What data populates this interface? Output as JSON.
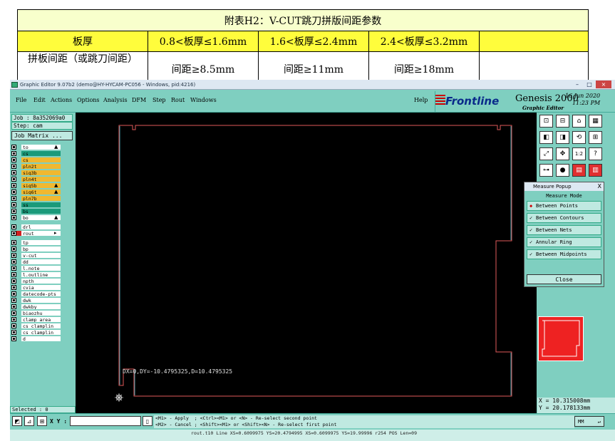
{
  "doc_table": {
    "title": "附表H2：V-CUT跳刀拼版间距参数",
    "header_row": [
      "板厚",
      "0.8<板厚≤1.6mm",
      "1.6<板厚≤2.4mm",
      "2.4<板厚≤3.2mm",
      ""
    ],
    "data_row": [
      "拼板间距（或跳刀间距）",
      "间距≥8.5mm",
      "间距≥11mm",
      "间距≥18mm",
      ""
    ]
  },
  "window": {
    "title": "Graphic Editor 9.07b2 (demo@HY-HYCAM-PC056 - Windows, pid:4216)",
    "controls": [
      "–",
      "□",
      "×"
    ]
  },
  "menu": {
    "items": [
      "File",
      "Edit",
      "Actions",
      "Options",
      "Analysis",
      "DFM",
      "Step",
      "Rout",
      "Windows"
    ],
    "help": "Help"
  },
  "branding": {
    "logo": "Frontline",
    "product": "Genesis 2000",
    "date": "16 Jun 2020",
    "time": "11:23 PM",
    "subtitle": "Graphic Editor"
  },
  "job": {
    "job_line": "Job : 8a352069a0",
    "step_line": "Step: cam",
    "matrix_button": "Job Matrix ..."
  },
  "layers": {
    "group1": [
      {
        "name": "to",
        "bg": "#ffffff",
        "arrow": "▲"
      },
      {
        "name": "cs",
        "bg": "#1a9a7a",
        "arrow": ""
      },
      {
        "name": "cs",
        "bg": "#f0b830",
        "arrow": ""
      },
      {
        "name": "pln2t",
        "bg": "#f0b830",
        "arrow": ""
      },
      {
        "name": "sig3b",
        "bg": "#f0b830",
        "arrow": ""
      },
      {
        "name": "pln4t",
        "bg": "#f0b830",
        "arrow": ""
      },
      {
        "name": "sig5b",
        "bg": "#f0b830",
        "arrow": "▲"
      },
      {
        "name": "sig6t",
        "bg": "#f0b830",
        "arrow": "▲"
      },
      {
        "name": "pln7b",
        "bg": "#f0b830",
        "arrow": ""
      },
      {
        "name": "ss",
        "bg": "#1a9a7a",
        "arrow": ""
      },
      {
        "name": "bs",
        "bg": "#1a9a7a",
        "arrow": ""
      },
      {
        "name": "bo",
        "bg": "#ffffff",
        "arrow": "▲"
      }
    ],
    "group2": [
      {
        "name": "drl",
        "bg": "#ffffff",
        "arrow": ""
      },
      {
        "name": "rout",
        "bg": "#ffffff",
        "arrow": "▸"
      }
    ],
    "group3": [
      {
        "name": "tp",
        "bg": "#ffffff"
      },
      {
        "name": "bp",
        "bg": "#ffffff"
      },
      {
        "name": "v-cut",
        "bg": "#ffffff"
      },
      {
        "name": "dd",
        "bg": "#ffffff"
      },
      {
        "name": "l.note",
        "bg": "#ffffff"
      },
      {
        "name": "l.outline",
        "bg": "#ffffff"
      },
      {
        "name": "npth",
        "bg": "#ffffff"
      },
      {
        "name": "cvia",
        "bg": "#ffffff"
      },
      {
        "name": "datecode-pts",
        "bg": "#ffffff"
      },
      {
        "name": "dwk",
        "bg": "#ffffff"
      },
      {
        "name": "dwkby",
        "bg": "#ffffff"
      },
      {
        "name": "biaozhu",
        "bg": "#ffffff"
      },
      {
        "name": "clamp_area",
        "bg": "#ffffff"
      },
      {
        "name": "cs_clamplin",
        "bg": "#ffffff"
      },
      {
        "name": "cs_clamplin",
        "bg": "#ffffff"
      },
      {
        "name": "d",
        "bg": "#ffffff"
      }
    ]
  },
  "selected": "Selected : 0",
  "canvas": {
    "measure_readout": "DX=0,DY=-10.4795325,D=10.4795325"
  },
  "measure_popup": {
    "title": "Measure Popup",
    "close_x": "X",
    "header": "Measure Mode",
    "options": [
      {
        "label": "Between Points",
        "selected": true
      },
      {
        "label": "Between Contours",
        "selected": false
      },
      {
        "label": "Between Nets",
        "selected": false
      },
      {
        "label": "Annular Ring",
        "selected": false
      },
      {
        "label": "Between Midpoints",
        "selected": false
      }
    ],
    "close_label": "Close"
  },
  "coordinates": {
    "x": "X = 10.315008mm",
    "y": "Y = 20.178133mm"
  },
  "bottom": {
    "xy_label": "X Y :",
    "xy_value": "",
    "help_line1": "<M1> - Apply  ; <Ctrl><M1> or <N> - Re-select second point",
    "help_line2": "<M2> - Cancel ; <Shift><M1> or <Shift><N> - Re-select first point",
    "units": "MM",
    "status": "rout.t10 Line XS=0.6099975 YS=20.4794995 XS=0.6099975 YS=19.99996 r254 POS Len=09"
  }
}
